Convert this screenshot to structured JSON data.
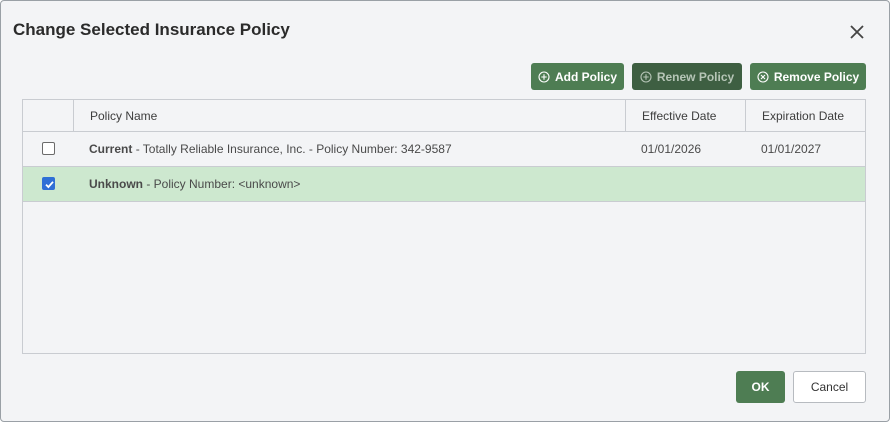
{
  "dialog": {
    "title": "Change Selected Insurance Policy",
    "close_icon": "close-icon"
  },
  "toolbar": {
    "add_label": "Add Policy",
    "renew_label": "Renew Policy",
    "remove_label": "Remove Policy",
    "renew_disabled": true
  },
  "table": {
    "headers": {
      "policy_name": "Policy Name",
      "effective_date": "Effective Date",
      "expiration_date": "Expiration Date"
    },
    "rows": [
      {
        "checked": false,
        "status": "Current",
        "details": "- Totally Reliable Insurance, Inc. - Policy Number: 342-9587",
        "effective_date": "01/01/2026",
        "expiration_date": "01/01/2027"
      },
      {
        "checked": true,
        "status": "Unknown",
        "details": "- Policy Number: <unknown>",
        "effective_date": "",
        "expiration_date": ""
      }
    ]
  },
  "footer": {
    "ok_label": "OK",
    "cancel_label": "Cancel"
  },
  "colors": {
    "accent": "#4e7d53",
    "selected_row": "#cde8cf",
    "checkbox": "#2f6fd6"
  }
}
